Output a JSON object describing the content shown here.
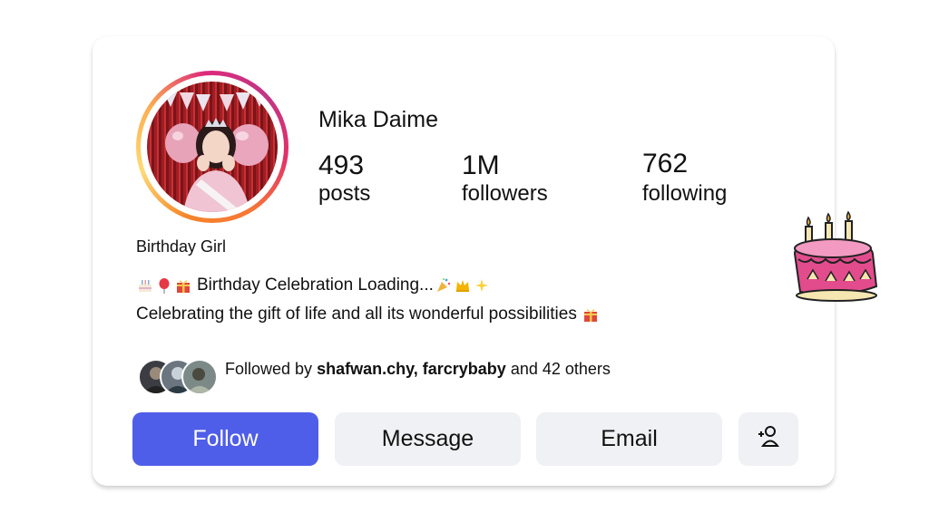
{
  "profile": {
    "name": "Mika Daime",
    "stats": [
      {
        "value": "493",
        "label": "posts"
      },
      {
        "value": "1M",
        "label": "followers"
      },
      {
        "value": "762",
        "label": "following"
      }
    ],
    "bio_title": "Birthday Girl",
    "bio_line1": "Birthday Celebration Loading...",
    "bio_line2": "Celebrating the gift of life and all its wonderful possibilities",
    "followed_by_prefix": "Followed by",
    "followed_by_users": "shafwan.chy, farcrybaby",
    "followed_by_suffix": "and 42 others"
  },
  "actions": {
    "follow": "Follow",
    "message": "Message",
    "email": "Email",
    "add_icon": "add-person-icon"
  },
  "icons": [
    "cake-emoji",
    "balloon-emoji",
    "gift-emoji",
    "party-popper-emoji",
    "crown-emoji",
    "sparkles-emoji",
    "birthday-cake-sticker"
  ],
  "colors": {
    "follow_button": "#4f5ee8",
    "secondary_button": "#f0f1f4",
    "ring_gradient": [
      "#f58529",
      "#dd2a7b",
      "#c13584"
    ]
  }
}
